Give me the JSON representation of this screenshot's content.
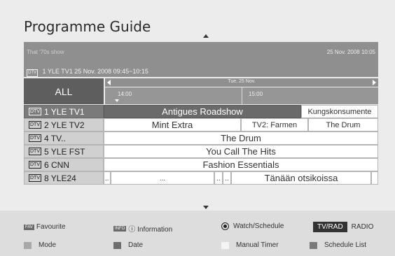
{
  "title": "Programme Guide",
  "info": {
    "show": "That '70s show",
    "date": "25 Nov. 2008 10:05",
    "channel_tag": "DTV",
    "channel_line": "1 YLE TV1 25 Nov. 2008 09:45~10:15"
  },
  "filter": "ALL",
  "timebar": {
    "date": "Tue. 25 Nov.",
    "times": [
      "14:00",
      "15:00"
    ]
  },
  "channels": [
    {
      "tag": "DTV",
      "name": "1  YLE TV1"
    },
    {
      "tag": "DTV",
      "name": "2  YLE TV2"
    },
    {
      "tag": "DTV",
      "name": "4  TV.."
    },
    {
      "tag": "DTV",
      "name": "5  YLE FST"
    },
    {
      "tag": "DTV",
      "name": "6  CNN"
    },
    {
      "tag": "DTV",
      "name": "8  YLE24"
    }
  ],
  "programmes": {
    "r1": [
      "Antigues Roadshow",
      "Kungskonsumente"
    ],
    "r2": [
      "Mint Extra",
      "TV2: Farmen",
      "The Drum"
    ],
    "r3": [
      "The Drum"
    ],
    "r4": [
      "You Call The Hits"
    ],
    "r5": [
      "Fashion Essentials"
    ],
    "r6": [
      "..",
      "...",
      "..",
      "..",
      "Tänään otsikoissa",
      ""
    ]
  },
  "legend": {
    "fav_tag": "FAV",
    "favourite": "Favourite",
    "info_tag": "INFO",
    "information": "ⓘ Information",
    "watch": "Watch/Schedule",
    "tvrad": "TV/RAD",
    "radio": "RADIO",
    "mode": "Mode",
    "date": "Date",
    "manual": "Manual Timer",
    "schedule": "Schedule List"
  },
  "colors": {
    "red": "#a8a8a8",
    "green": "#6e6e6e",
    "yellow": "#f4f4f4",
    "blue": "#7a7a7a"
  }
}
